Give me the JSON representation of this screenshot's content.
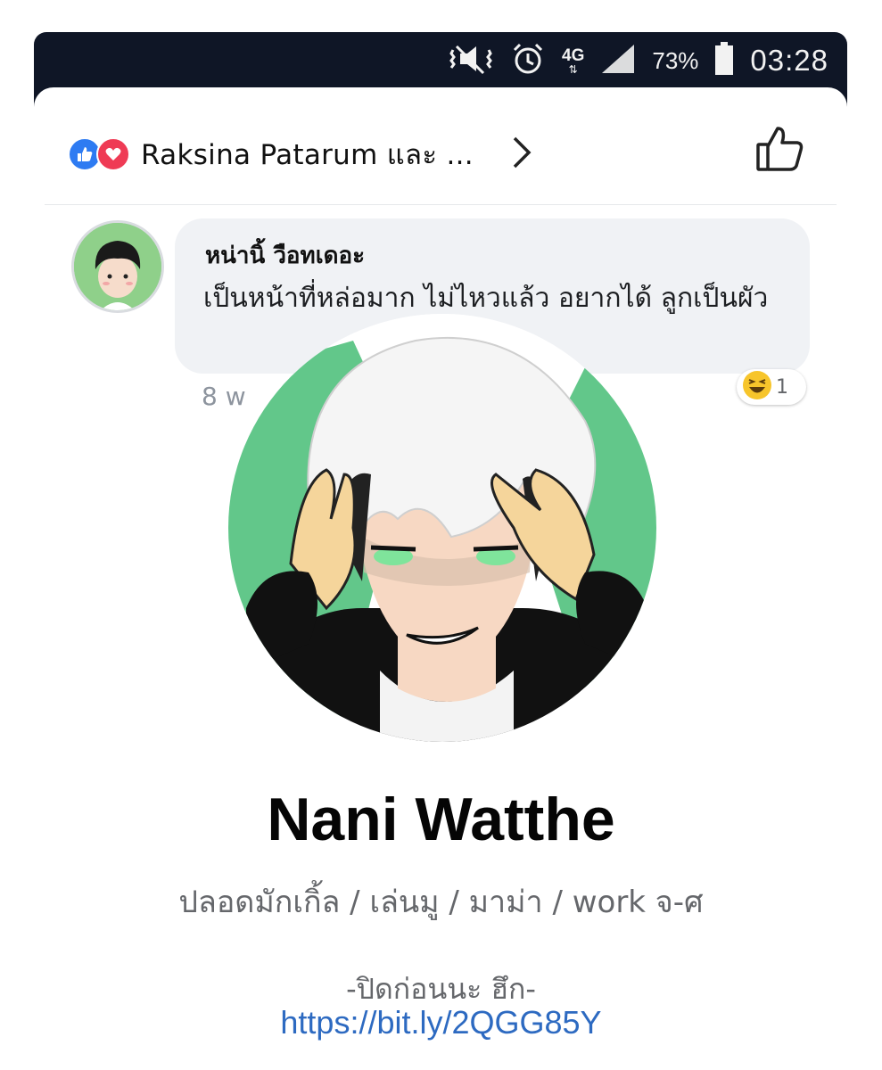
{
  "status_bar": {
    "network": "4G",
    "battery_percent": "73%",
    "time": "03:28",
    "icons": [
      "vibrate-mute-icon",
      "alarm-icon",
      "data-arrows-icon",
      "signal-icon",
      "battery-icon"
    ]
  },
  "reactions": {
    "summary": "Raksina Patarum และ ...",
    "icons": [
      "like-reaction-icon",
      "love-reaction-icon"
    ],
    "colors": {
      "like": "#2e7bf2",
      "love": "#ef3b55"
    }
  },
  "comment": {
    "author": "หน่านิ้ วือทเดอะ",
    "text": "เป็นหน้าที่หล่อมาก ไม่ไหวแล้ว อยากได้ ลูกเป็นผัว",
    "time": "8 w",
    "reaction_count": "1",
    "reaction_icon": "haha-reaction-icon"
  },
  "profile": {
    "name": "Nani Watthe",
    "bio": "ปลอดมักเกิ้ล / เล่นมู / มาม่า / work จ-ศ",
    "note": "-ปิดก่อนนะ ฮึก-",
    "link": "https://bit.ly/2QGG85Y",
    "link_color": "#2d6ac1"
  }
}
